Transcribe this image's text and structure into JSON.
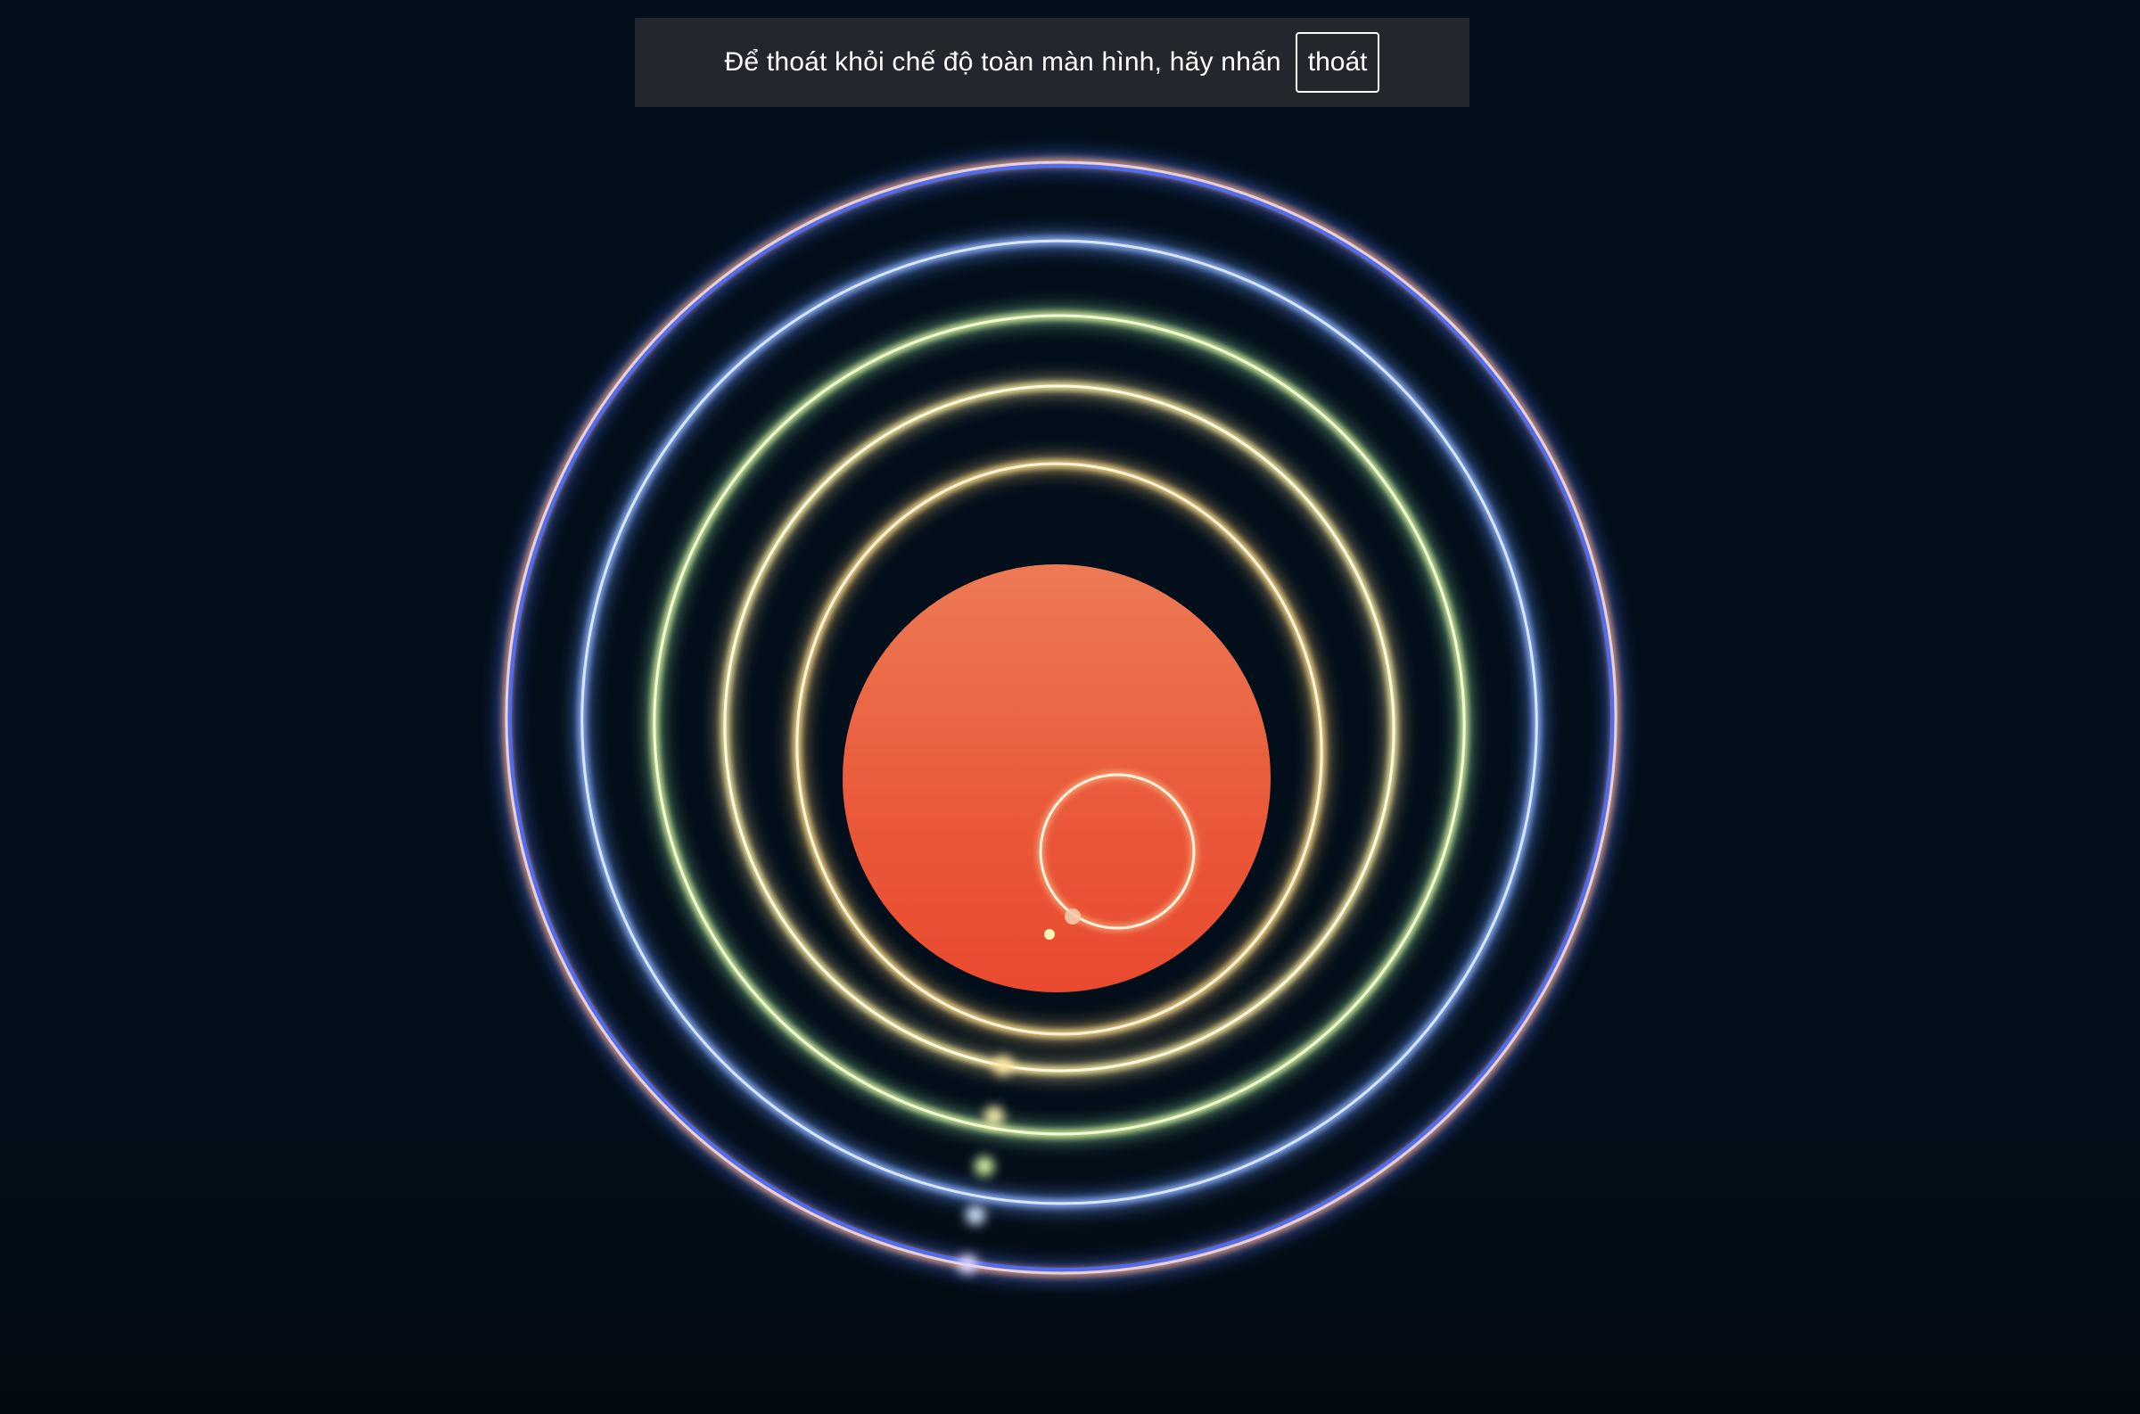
{
  "fullscreen_notice": {
    "message": "Để thoát khỏi chế độ toàn màn hình, hãy nhấn",
    "exit_label": "thoát"
  },
  "scene": {
    "background_color": "#020e19",
    "sun_color_top": "#ec7a55",
    "sun_color_bottom": "#e94a2f",
    "orbit_colors": [
      "#ffd98a",
      "#fff2a0",
      "#c9f5a8",
      "#b8d6ff",
      "#cfc3ff"
    ]
  }
}
